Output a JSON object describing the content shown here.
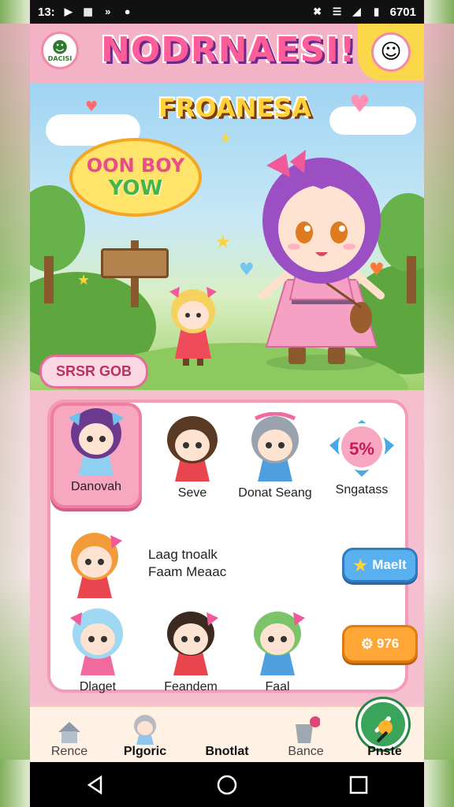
{
  "status_bar": {
    "time": "13:",
    "battery": "6701"
  },
  "header": {
    "badge_text": "DACISI",
    "title": "NODRNAESI!",
    "subtitle": "FROANESA"
  },
  "scene": {
    "bubble_line1": "OON BOY",
    "bubble_line2": "YOW",
    "label": "SRSR GOB"
  },
  "characters": {
    "row1": [
      {
        "name": "Danovah",
        "selected": true
      },
      {
        "name": "Seve",
        "selected": false
      },
      {
        "name": "Donat Seang",
        "selected": false
      },
      {
        "name": "Sngatass",
        "selected": false,
        "badge": "5%"
      }
    ],
    "list_item": {
      "line1": "Laag  tnoalk",
      "line2": "Faam Meaac",
      "button": "Maelt"
    },
    "row3": [
      {
        "name": "Dlaget"
      },
      {
        "name": "Feandem"
      },
      {
        "name": "Faal"
      }
    ],
    "orange_button": "976"
  },
  "bottom_nav": {
    "items": [
      {
        "label": "Rence",
        "icon": "house-icon"
      },
      {
        "label": "Plgoric",
        "icon": "chibi-icon"
      },
      {
        "label": "Bnotlat",
        "icon": "brush-icon"
      },
      {
        "label": "Bance",
        "icon": "bucket-icon"
      },
      {
        "label": "Pnste",
        "icon": "paint-icon"
      }
    ]
  },
  "colors": {
    "accent_pink": "#f39bb7",
    "button_blue": "#5ab0ee",
    "button_orange": "#ffa636",
    "center_green": "#3aa55a"
  }
}
